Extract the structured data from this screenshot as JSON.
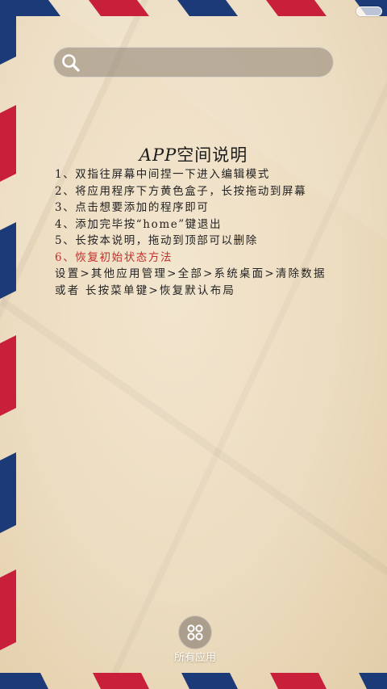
{
  "colors": {
    "stripe_red": "#c8203a",
    "stripe_blue": "#1d3a78",
    "accent_red": "#c0302a"
  },
  "search": {
    "placeholder": ""
  },
  "note": {
    "title_latin": "APP",
    "title_rest": "空间说明",
    "lines": [
      "1、双指往屏幕中间捏一下进入编辑模式",
      "2、将应用程序下方黄色盒子，长按拖动到屏幕",
      "3、点击想要添加的程序即可",
      "4、添加完毕按“home”键退出",
      "5、长按本说明，拖动到顶部可以删除"
    ],
    "restore_heading": "6、恢复初始状态方法",
    "restore_steps": [
      "设置>其他应用管理>全部>系统桌面>清除数据",
      "或者 长按菜单键>恢复默认布局"
    ]
  },
  "dock": {
    "all_apps_label": "所有应用",
    "all_apps_icon": "grid-icon"
  }
}
